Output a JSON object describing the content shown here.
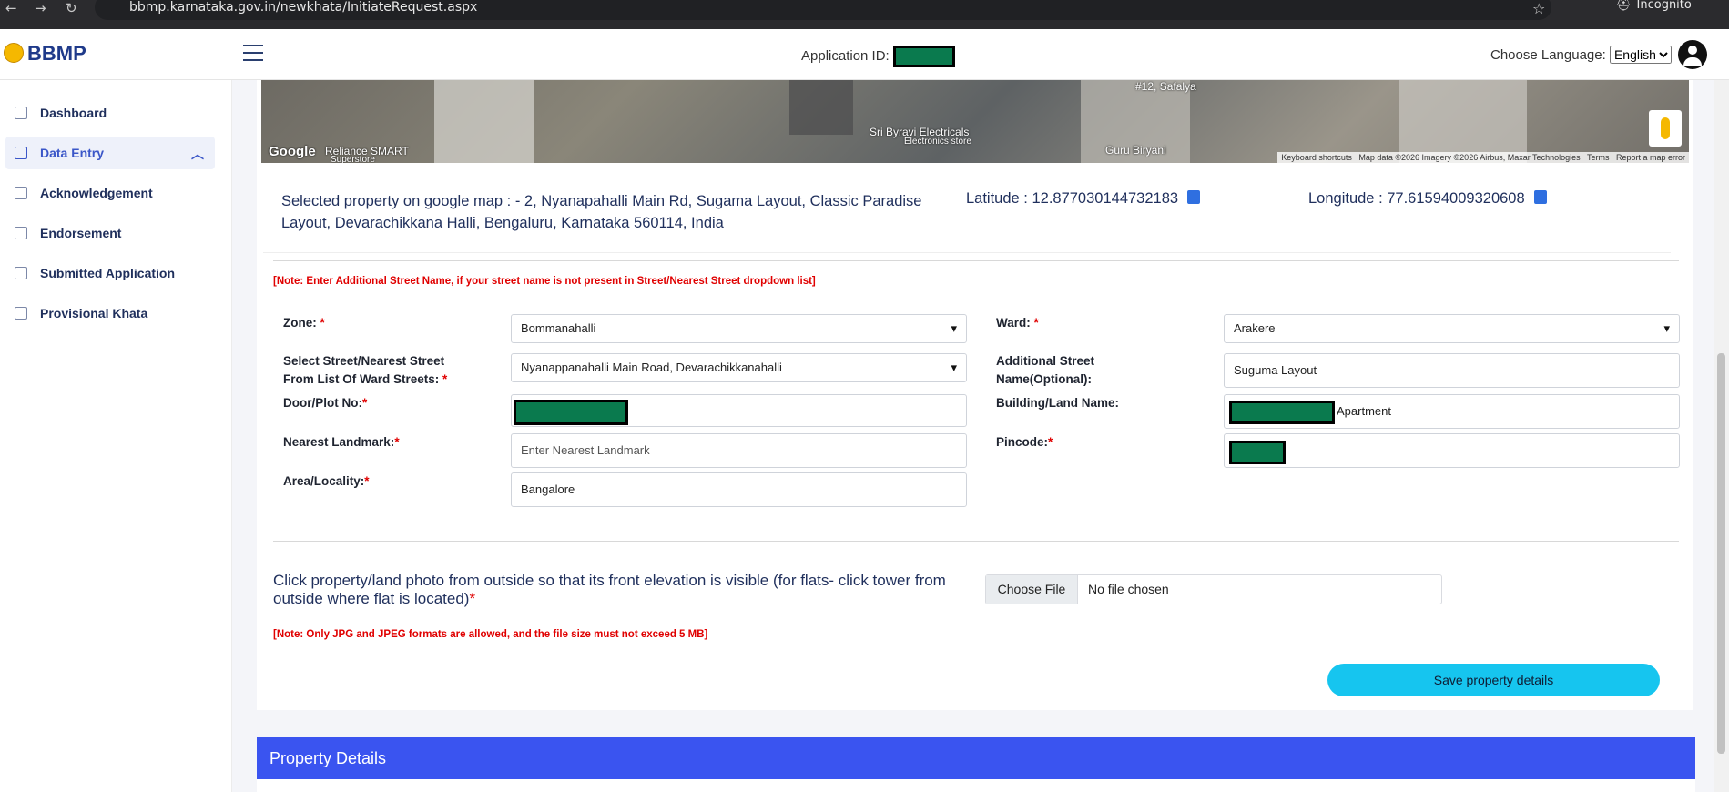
{
  "browser": {
    "url": "bbmp.karnataka.gov.in/newkhata/InitiateRequest.aspx",
    "profile_label": "Incognito"
  },
  "header": {
    "logo_text": "BBMP",
    "application_id_label": "Application ID:",
    "choose_language_label": "Choose Language:",
    "language_selected": "English"
  },
  "sidebar": {
    "items": [
      {
        "label": "Dashboard"
      },
      {
        "label": "Data Entry"
      },
      {
        "label": "Acknowledgement"
      },
      {
        "label": "Endorsement"
      },
      {
        "label": "Submitted Application"
      },
      {
        "label": "Provisional Khata"
      }
    ]
  },
  "map": {
    "labels": [
      "#12, Safalya",
      "Sri Byravi Electricals",
      "Electronics store",
      "Guru Biryani",
      "Reliance SMART",
      "Superstore"
    ],
    "google_mark": "Google",
    "attribution": [
      "Keyboard shortcuts",
      "Map data ©2026 Imagery ©2026 Airbus, Maxar Technologies",
      "Terms",
      "Report a map error"
    ]
  },
  "selected": {
    "address_text": "Selected property on google map : - 2, Nyanapahalli Main Rd, Sugama Layout, Classic Paradise Layout, Devarachikkana Halli, Bengaluru, Karnataka 560114, India",
    "latitude_text": "Latitude : 12.877030144732183",
    "longitude_text": "Longitude : 77.61594009320608"
  },
  "notes": {
    "street_note": "[Note: Enter Additional Street Name, if your street name is not present in Street/Nearest Street dropdown list]",
    "photo_note": "[Note: Only JPG and JPEG formats are allowed, and the file size must not exceed 5 MB]"
  },
  "form": {
    "zone_label": "Zone:",
    "zone_value": "Bommanahalli",
    "ward_label": "Ward:",
    "ward_value": "Arakere",
    "street_label_1": "Select Street/Nearest Street",
    "street_label_2": "From List Of Ward Streets:",
    "street_value": "Nyanappanahalli Main Road, Devarachikkanahalli",
    "addl_street_label_1": "Additional Street",
    "addl_street_label_2": "Name(Optional):",
    "addl_street_value": "Suguma Layout",
    "door_label": "Door/Plot No:",
    "building_label": "Building/Land Name:",
    "building_value_suffix": "Apartment",
    "landmark_label": "Nearest Landmark:",
    "landmark_placeholder": "Enter Nearest Landmark",
    "pincode_label": "Pincode:",
    "area_label": "Area/Locality:",
    "area_value": "Bangalore",
    "required_mark": "*"
  },
  "photo": {
    "question": "Click property/land photo from outside so that its front elevation is visible (for flats- click tower from outside where flat is located)",
    "choose_file_label": "Choose File",
    "no_file_text": "No file chosen"
  },
  "actions": {
    "save_label": "Save property details"
  },
  "section": {
    "property_details_title": "Property Details"
  },
  "colors": {
    "accent_blue": "#3a54f0",
    "save_button": "#16c5ef",
    "required_red": "#e00000",
    "redaction_green": "#0a7a4e"
  }
}
